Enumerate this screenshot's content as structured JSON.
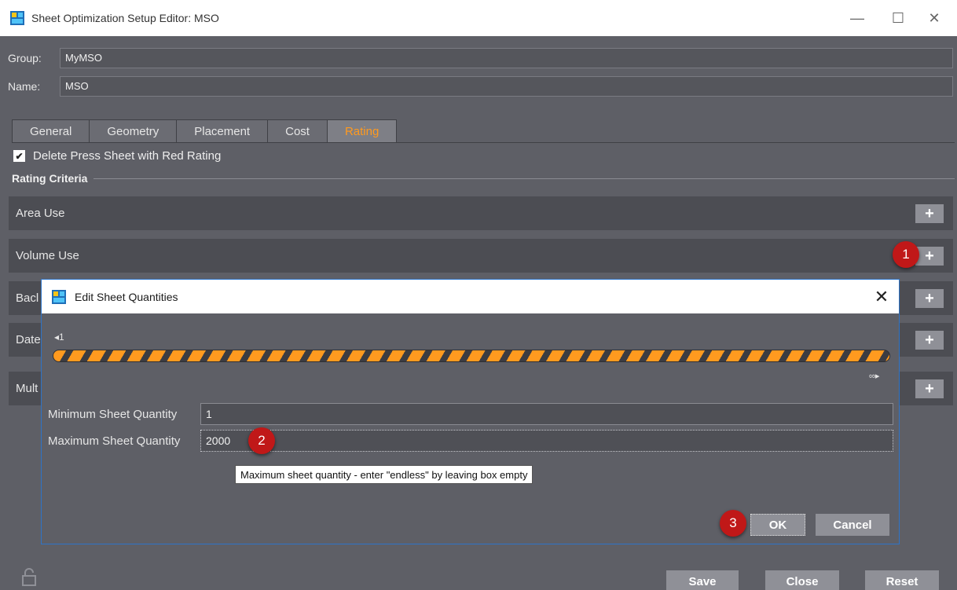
{
  "window": {
    "title": "Sheet Optimization Setup Editor: MSO"
  },
  "fields": {
    "group_label": "Group:",
    "group_value": "MyMSO",
    "name_label": "Name:",
    "name_value": "MSO"
  },
  "tabs": [
    {
      "label": "General"
    },
    {
      "label": "Geometry"
    },
    {
      "label": "Placement"
    },
    {
      "label": "Cost"
    },
    {
      "label": "Rating",
      "active": true
    }
  ],
  "checkbox": {
    "label": "Delete Press Sheet with Red Rating",
    "checked": true
  },
  "rating_criteria": {
    "title": "Rating Criteria",
    "items": [
      {
        "label": "Area Use"
      },
      {
        "label": "Volume Use"
      },
      {
        "label": "Bacl"
      },
      {
        "label": "Date"
      },
      {
        "label": "Mult"
      }
    ],
    "add_glyph": "+"
  },
  "dialog": {
    "title": "Edit Sheet Quantities",
    "range_min_label": "◂1",
    "range_max_label": "∞▸",
    "min_label": "Minimum Sheet Quantity",
    "min_value": "1",
    "max_label": "Maximum Sheet Quantity",
    "max_value": "2000",
    "tooltip": "Maximum sheet quantity - enter \"endless\" by leaving box empty",
    "ok_label": "OK",
    "cancel_label": "Cancel"
  },
  "badges": {
    "b1": "1",
    "b2": "2",
    "b3": "3"
  },
  "footer": {
    "save_label": "Save",
    "close_label": "Close",
    "reset_label": "Reset"
  },
  "colors": {
    "accent": "#ff9a1f",
    "badge": "#c01818",
    "background": "#5e5f66"
  }
}
